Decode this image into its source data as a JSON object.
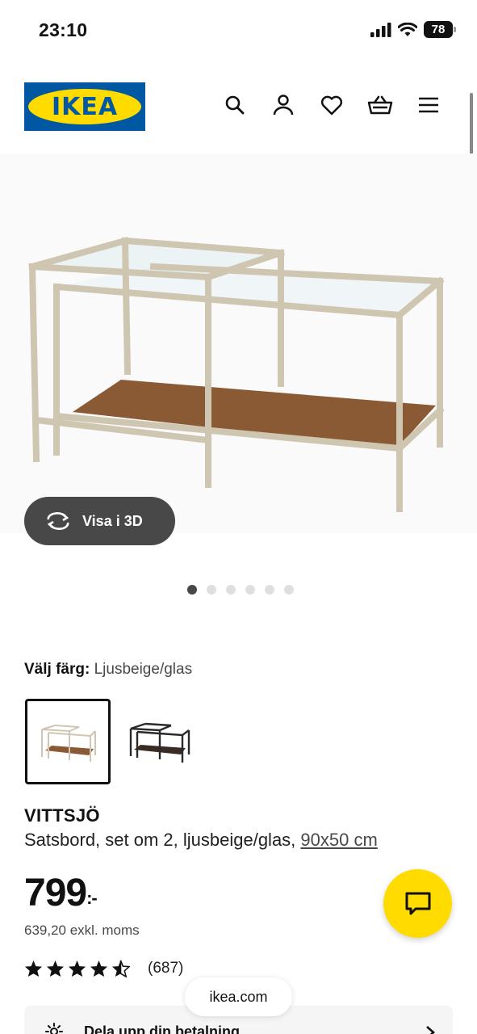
{
  "status_bar": {
    "time": "23:10",
    "battery": "78"
  },
  "header": {
    "logo_text": "IKEA",
    "icons": [
      "search-icon",
      "user-icon",
      "heart-icon",
      "basket-icon",
      "menu-icon"
    ]
  },
  "gallery": {
    "view3d_label": "Visa i 3D",
    "image_count": 6,
    "active_index": 0
  },
  "color": {
    "label": "Välj färg:",
    "selected": "Ljusbeige/glas",
    "swatches": [
      "Ljusbeige/glas",
      "Svartbrun/glas"
    ]
  },
  "product": {
    "name": "VITTSJÖ",
    "description": "Satsbord, set om 2, ljusbeige/glas,",
    "size_link": "90x50 cm",
    "price": "799",
    "currency": ":-",
    "price_ex_vat": "639,20 exkl. moms",
    "rating": 4.5,
    "review_count": "(687)"
  },
  "browser": {
    "url": "ikea.com"
  },
  "payment": {
    "label": "Dela upp din betalning"
  },
  "colors": {
    "ikea_blue": "#0058a3",
    "ikea_yellow": "#ffdb00",
    "button_dark": "#484848"
  }
}
